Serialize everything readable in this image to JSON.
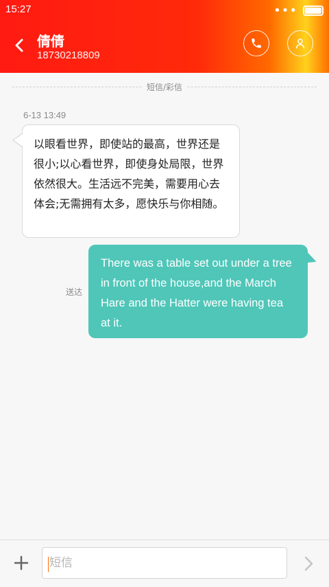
{
  "status_bar": {
    "time": "15:27",
    "more_dots": "•••"
  },
  "header": {
    "contact_name": "倩倩",
    "contact_number": "18730218809"
  },
  "conversation": {
    "message_type_label": "短信/彩信",
    "incoming": {
      "timestamp": "6-13 13:49",
      "text": "以眼看世界，即使站的最高，世界还是很小;以心看世界，即使身处局限，世界依然很大。生活远不完美，需要用心去体会;无需拥有太多，愿快乐与你相随。"
    },
    "outgoing": {
      "status": "送达",
      "text": "There was a table set out under a tree in front of the house,and the March Hare and the Hatter were having tea at it."
    }
  },
  "composer": {
    "placeholder": "短信"
  },
  "colors": {
    "header_red": "#ff1a12",
    "outgoing_bubble": "#4fc6b8",
    "accent_orange": "#ff6a00"
  }
}
